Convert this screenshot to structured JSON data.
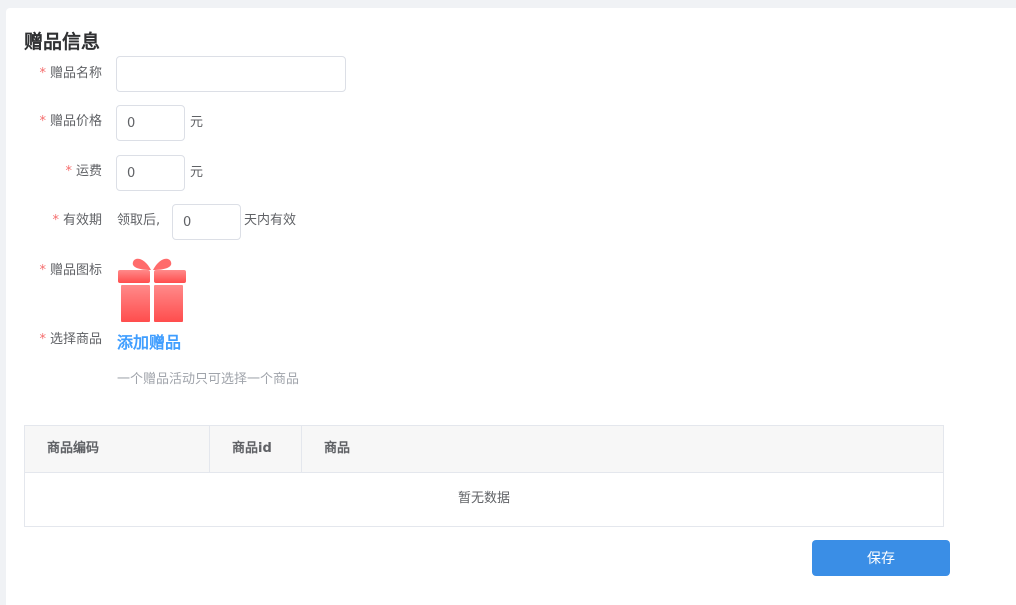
{
  "form": {
    "section_title": "赠品信息",
    "required_mark": "*",
    "fields": {
      "name": {
        "label": "赠品名称",
        "value": ""
      },
      "price": {
        "label": "赠品价格",
        "value": "0",
        "unit": "元"
      },
      "shipping": {
        "label": "运费",
        "value": "0",
        "unit": "元"
      },
      "validity": {
        "label": "有效期",
        "prefix": "领取后,",
        "value": "0",
        "suffix": "天内有效"
      },
      "icon": {
        "label": "赠品图标",
        "icon_name": "gift-icon",
        "color": "#ff5c5c"
      },
      "product": {
        "label": "选择商品",
        "link": "添加赠品",
        "hint": "一个赠品活动只可选择一个商品"
      }
    }
  },
  "table": {
    "columns": [
      "商品编码",
      "商品id",
      "商品"
    ],
    "empty_text": "暂无数据"
  },
  "actions": {
    "save_label": "保存"
  },
  "colors": {
    "accent": "#409eff",
    "primary_button": "#3a8ee6",
    "required": "#f56c6c"
  }
}
